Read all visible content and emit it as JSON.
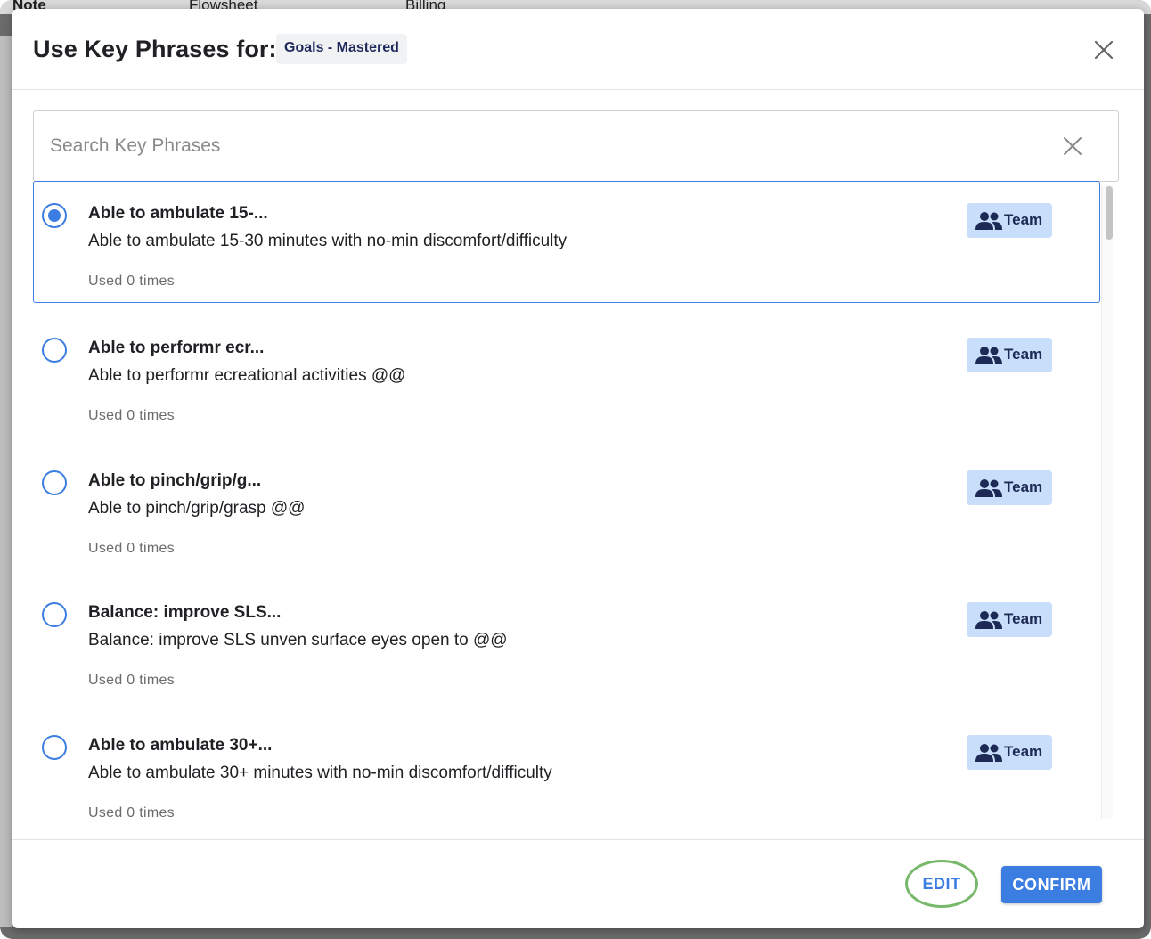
{
  "background": {
    "tabs": [
      "Note",
      "Flowsheet",
      "Billing"
    ]
  },
  "modal": {
    "title": "Use Key Phrases for:",
    "chip": "Goals - Mastered",
    "close_icon": "close-icon"
  },
  "search": {
    "placeholder": "Search Key Phrases",
    "value": "",
    "clear_icon": "close-icon"
  },
  "items": [
    {
      "title": "Able to ambulate 15-...",
      "text": "Able to ambulate 15-30 minutes with no-min discomfort/difficulty",
      "used": "Used 0 times",
      "badge": "Team",
      "selected": true
    },
    {
      "title": "Able to performr ecr...",
      "text": "Able to performr ecreational activities @@",
      "used": "Used 0 times",
      "badge": "Team",
      "selected": false
    },
    {
      "title": "Able to pinch/grip/g...",
      "text": "Able to pinch/grip/grasp @@",
      "used": "Used 0 times",
      "badge": "Team",
      "selected": false
    },
    {
      "title": "Balance: improve SLS...",
      "text": "Balance: improve SLS unven surface eyes open to @@",
      "used": "Used 0 times",
      "badge": "Team",
      "selected": false
    },
    {
      "title": "Able to ambulate 30+...",
      "text": "Able to ambulate 30+ minutes with no-min discomfort/difficulty",
      "used": "Used 0 times",
      "badge": "Team",
      "selected": false
    }
  ],
  "footer": {
    "edit_label": "EDIT",
    "confirm_label": "CONFIRM"
  },
  "colors": {
    "accent": "#3b7de0",
    "badge_bg": "#c9defa",
    "highlight_ring": "#78b86b"
  }
}
